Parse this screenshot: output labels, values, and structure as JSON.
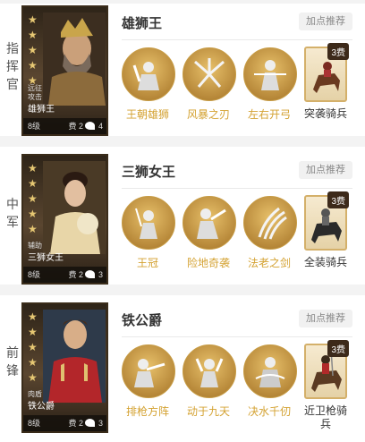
{
  "rows": [
    {
      "position": "指挥官",
      "general": {
        "name": "雄狮王",
        "role_line1": "远征",
        "role_line2": "攻击",
        "card_name": "雄狮王",
        "level": "8级",
        "cost": "费 2",
        "troops": "4"
      },
      "recommend_label": "加点推荐",
      "skills": [
        {
          "label": "王朝雄狮"
        },
        {
          "label": "风暴之刃"
        },
        {
          "label": "左右开弓"
        }
      ],
      "troop": {
        "cost_badge": "3费",
        "label": "突袭骑兵"
      }
    },
    {
      "position": "中军",
      "general": {
        "name": "三狮女王",
        "role_line1": "辅助",
        "card_name": "三狮女王",
        "level": "8级",
        "cost": "费 2",
        "troops": "3"
      },
      "recommend_label": "加点推荐",
      "skills": [
        {
          "label": "王冠"
        },
        {
          "label": "险地奇袭"
        },
        {
          "label": "法老之剑"
        }
      ],
      "troop": {
        "cost_badge": "3费",
        "label": "全装骑兵"
      }
    },
    {
      "position": "前锋",
      "general": {
        "name": "铁公爵",
        "role_line1": "肉盾",
        "card_name": "铁公爵",
        "level": "8级",
        "cost": "费 2",
        "troops": "3"
      },
      "recommend_label": "加点推荐",
      "skills": [
        {
          "label": "排枪方阵"
        },
        {
          "label": "动于九天"
        },
        {
          "label": "决水千仞"
        }
      ],
      "troop": {
        "cost_badge": "3费",
        "label": "近卫枪骑兵"
      }
    }
  ]
}
